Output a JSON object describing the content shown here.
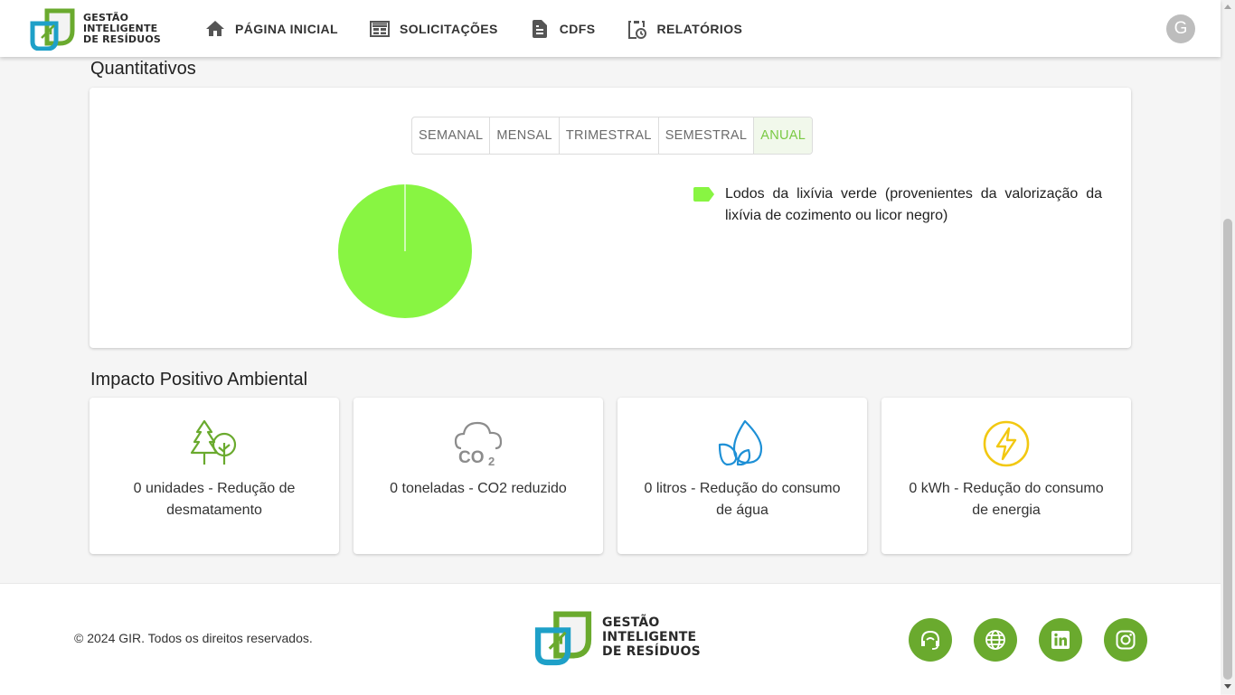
{
  "brand": {
    "line1": "GESTÃO",
    "line2": "INTELIGENTE",
    "line3": "DE RESÍDUOS"
  },
  "nav": [
    {
      "label": "PÁGINA INICIAL",
      "icon": "home-icon"
    },
    {
      "label": "SOLICITAÇÕES",
      "icon": "calendar-view-icon"
    },
    {
      "label": "CDFS",
      "icon": "document-icon"
    },
    {
      "label": "RELATÓRIOS",
      "icon": "clipboard-clock-icon"
    }
  ],
  "user": {
    "initial": "G"
  },
  "quantitativos": {
    "title": "Quantitativos",
    "periods": [
      "SEMANAL",
      "MENSAL",
      "TRIMESTRAL",
      "SEMESTRAL",
      "ANUAL"
    ],
    "selected_period": "ANUAL",
    "legend": "Lodos da lixívia verde (provenientes da valorização da lixívia de cozimento ou licor negro)"
  },
  "chart_data": {
    "type": "pie",
    "slices": [
      {
        "label": "Lodos da lixívia verde (provenientes da valorização da lixívia de cozimento ou licor negro)",
        "value": 100,
        "color": "#88f542"
      }
    ],
    "legend_position": "right"
  },
  "impacto": {
    "title": "Impacto Positivo Ambiental",
    "cards": [
      {
        "text": "0 unidades - Redução de desmatamento",
        "icon": "trees-icon",
        "color": "#6aaa2e"
      },
      {
        "text": "0 toneladas - CO2 reduzido",
        "icon": "co2-cloud-icon",
        "color": "#8c8c8c"
      },
      {
        "text": "0 litros - Redução do consumo de água",
        "icon": "water-drop-leaf-icon",
        "color": "#1e90d6"
      },
      {
        "text": "0 kWh - Redução do consumo de energia",
        "icon": "lightning-icon",
        "color": "#f2c811"
      }
    ]
  },
  "footer": {
    "copyright": "© 2024 GIR. Todos os direitos reservados.",
    "social": [
      "support-headset-icon",
      "globe-icon",
      "linkedin-icon",
      "instagram-icon"
    ]
  },
  "colors": {
    "accent_green": "#7ac943",
    "social_bg": "#6aaa2e",
    "pie_green": "#88f542"
  }
}
